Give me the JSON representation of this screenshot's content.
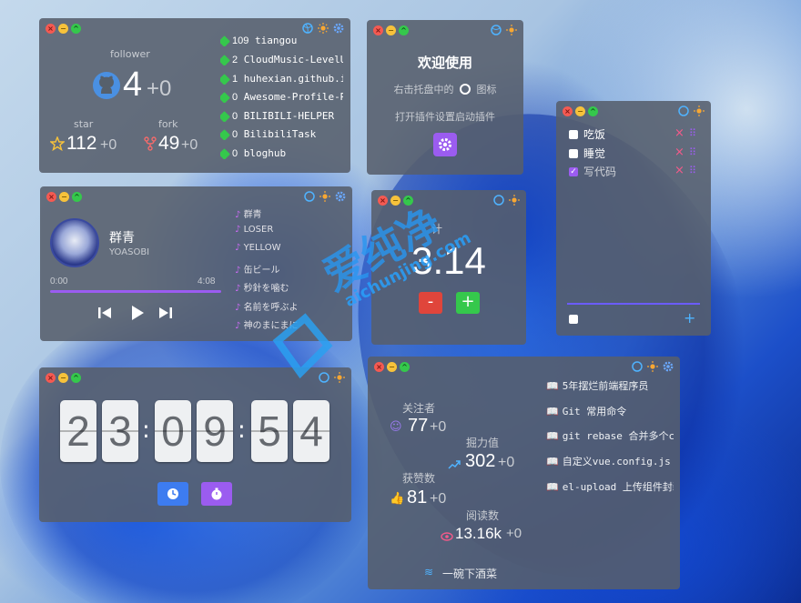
{
  "github": {
    "follower_label": "follower",
    "follower_count": "4",
    "follower_delta": "+0",
    "star_label": "star",
    "star_count": "112",
    "star_delta": "+0",
    "fork_label": "fork",
    "fork_count": "49",
    "fork_delta": "+0",
    "repos": [
      {
        "count": "109",
        "name": "tiangou"
      },
      {
        "count": "2",
        "name": "CloudMusic-LevelUp"
      },
      {
        "count": "1",
        "name": "huhexian.github.io"
      },
      {
        "count": "0",
        "name": "Awesome-Profile-README"
      },
      {
        "count": "0",
        "name": "BILIBILI-HELPER"
      },
      {
        "count": "0",
        "name": "BilibiliTask"
      },
      {
        "count": "0",
        "name": "bloghub"
      }
    ]
  },
  "welcome": {
    "title": "欢迎使用",
    "line1_before": "右击托盘中的",
    "line1_after": "图标",
    "line2": "打开插件设置启动插件"
  },
  "todo": {
    "items": [
      {
        "label": "吃饭",
        "checked": false
      },
      {
        "label": "睡觉",
        "checked": false
      },
      {
        "label": "写代码",
        "checked": true
      }
    ],
    "add_symbol": "+"
  },
  "music": {
    "title": "群青",
    "artist": "YOASOBI",
    "time_current": "0:00",
    "time_total": "4:08",
    "progress": 0.0,
    "playlist": [
      "群青",
      "LOSER",
      "YELLOW",
      "缶ビール",
      "秒針を噛む",
      "名前を呼ぶよ",
      "神のまにまに"
    ]
  },
  "counter": {
    "label": "计",
    "value": "3.14",
    "minus": "-",
    "plus": "+"
  },
  "clock": {
    "digits": [
      "2",
      "3",
      "0",
      "9",
      "5",
      "4"
    ],
    "separator": ":"
  },
  "juejin": {
    "followers_label": "关注者",
    "followers_value": "77",
    "followers_delta": "+0",
    "power_label": "掘力值",
    "power_value": "302",
    "power_delta": "+0",
    "likes_label": "获赞数",
    "likes_value": "81",
    "likes_delta": "+0",
    "reads_label": "阅读数",
    "reads_value": "13.16k",
    "reads_delta": "+0",
    "author": "一碗下酒菜",
    "articles": [
      "5年摆烂前端程序员",
      "Git 常用命令",
      "git rebase 合并多个commit",
      "自定义vue.config.js",
      "el-upload 上传组件封装"
    ]
  },
  "watermark": {
    "text": "爱纯净",
    "url": "aichunjing.com"
  },
  "colors": {
    "accent": "#9b5cf0",
    "clock_blue": "#3d7cf0",
    "green": "#35c84c",
    "red": "#e0453b",
    "github": "#4a90e2"
  }
}
